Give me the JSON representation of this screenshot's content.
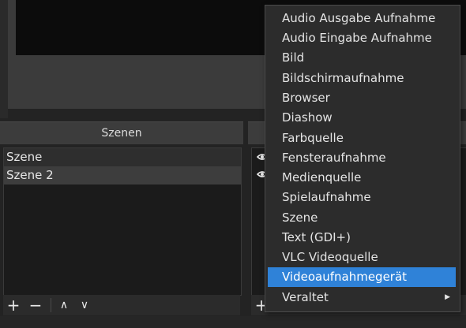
{
  "docks": {
    "scenes_title": "Szenen"
  },
  "scenes": {
    "items": [
      "Szene",
      "Szene 2"
    ]
  },
  "scenes_toolbar": {
    "add": "+",
    "remove": "−",
    "up": "∧",
    "down": "∨"
  },
  "sources_toolbar": {
    "add": "+"
  },
  "context_menu": {
    "items": [
      "Audio Ausgabe Aufnahme",
      "Audio Eingabe Aufnahme",
      "Bild",
      "Bildschirmaufnahme",
      "Browser",
      "Diashow",
      "Farbquelle",
      "Fensteraufnahme",
      "Medienquelle",
      "Spielaufnahme",
      "Szene",
      "Text (GDI+)",
      "VLC Videoquelle",
      "Videoaufnahmegerät",
      "Veraltet"
    ],
    "selected": "Videoaufnahmegerät",
    "submenu_arrow": "▶"
  },
  "colors": {
    "selection": "#2f82d8",
    "menu_bg": "#2c2c2c",
    "dock_title_bg": "#3c3c3c"
  }
}
